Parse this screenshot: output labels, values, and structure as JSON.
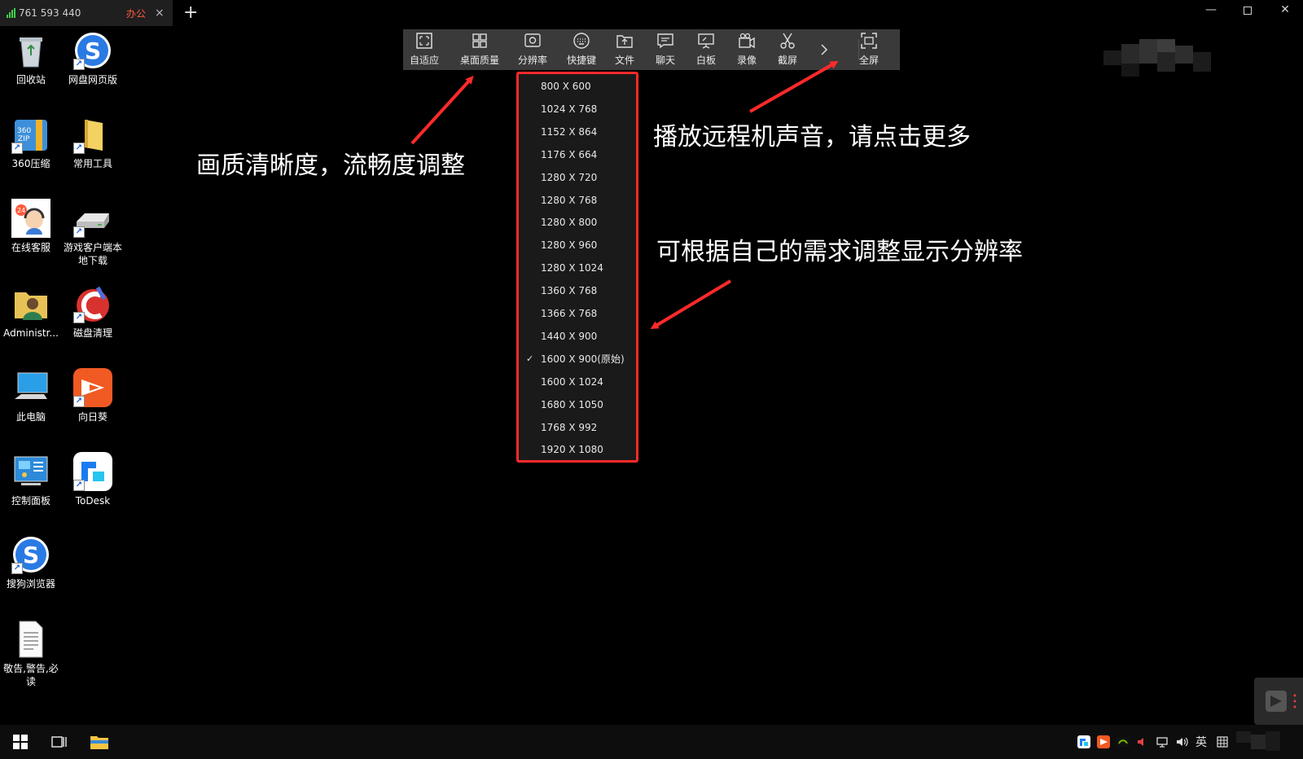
{
  "tab": {
    "id": "761 593 440",
    "tag": "办公",
    "close": "×",
    "new_tab": "+"
  },
  "window_controls": {
    "minimize": "—",
    "close": "✕"
  },
  "toolbar": {
    "items": [
      {
        "label": "自适应",
        "icon": "fit-icon"
      },
      {
        "label": "桌面质量",
        "icon": "grid-icon"
      },
      {
        "label": "分辨率",
        "icon": "resolution-icon"
      },
      {
        "label": "快捷键",
        "icon": "keyboard-icon"
      },
      {
        "label": "文件",
        "icon": "folder-upload-icon"
      },
      {
        "label": "聊天",
        "icon": "chat-icon"
      },
      {
        "label": "白板",
        "icon": "whiteboard-icon"
      },
      {
        "label": "录像",
        "icon": "video-icon"
      },
      {
        "label": "截屏",
        "icon": "scissors-icon"
      },
      {
        "label": "",
        "icon": "chevron-right-icon"
      },
      {
        "label": "全屏",
        "icon": "fullscreen-icon"
      }
    ]
  },
  "resolution_menu": {
    "selected_index": 12,
    "check": "✓",
    "options": [
      "800 X 600",
      "1024 X 768",
      "1152 X 864",
      "1176 X 664",
      "1280 X 720",
      "1280 X 768",
      "1280 X 800",
      "1280 X 960",
      "1280 X 1024",
      "1360 X 768",
      "1366 X 768",
      "1440 X 900",
      "1600 X 900(原始)",
      "1600 X 1024",
      "1680 X 1050",
      "1768 X 992",
      "1920 X 1080"
    ]
  },
  "annotations": {
    "quality": "画质清晰度，流畅度调整",
    "sound": "播放远程机声音，请点击更多",
    "resolution": "可根据自己的需求调整显示分辨率"
  },
  "desktop_icons": [
    {
      "name": "回收站",
      "icon": "recycle-bin-icon"
    },
    {
      "name": "网盘网页版",
      "icon": "sogou-s-icon"
    },
    {
      "name": "360压缩",
      "icon": "zip-icon"
    },
    {
      "name": "常用工具",
      "icon": "folder-icon"
    },
    {
      "name": "在线客服",
      "icon": "support-icon"
    },
    {
      "name": "游戏客户端本地下载",
      "icon": "drive-icon"
    },
    {
      "name": "Administr...",
      "icon": "user-folder-icon"
    },
    {
      "name": "磁盘清理",
      "icon": "ccleaner-icon"
    },
    {
      "name": "此电脑",
      "icon": "computer-icon"
    },
    {
      "name": "向日葵",
      "icon": "sunflower-icon"
    },
    {
      "name": "控制面板",
      "icon": "control-panel-icon"
    },
    {
      "name": "ToDesk",
      "icon": "todesk-icon"
    },
    {
      "name": "搜狗浏览器",
      "icon": "sogou-s-icon"
    },
    {
      "name": "敬告,警告,必读",
      "icon": "document-icon"
    }
  ],
  "taskbar": {
    "lang": "英",
    "tray_icons": [
      "todesk-tray-icon",
      "sunflower-tray-icon",
      "nvidia-icon",
      "volume-muted-icon",
      "network-icon",
      "volume-icon",
      "ime-icon"
    ]
  },
  "colors": {
    "highlight": "#ff2a2a",
    "toolbar_bg": "#3a3a3a",
    "tab_tag": "#ff5a3c"
  }
}
